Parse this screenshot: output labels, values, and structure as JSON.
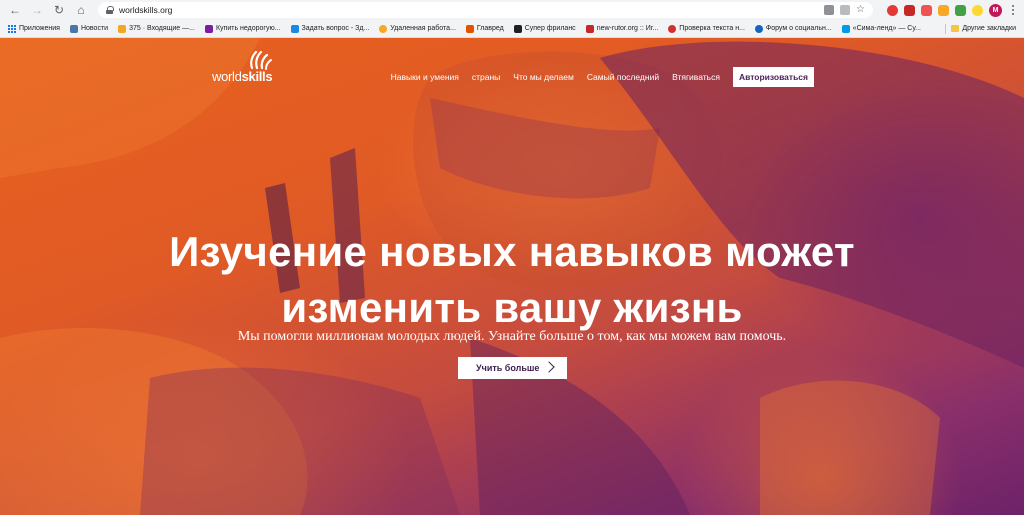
{
  "browser": {
    "url": "worldskills.org",
    "bookmarks": [
      {
        "label": "Приложения",
        "color": "#1a73e8"
      },
      {
        "label": "Новости",
        "color": "#4a76a8"
      },
      {
        "label": "375 · Входящие —...",
        "color": "#f5a623"
      },
      {
        "label": "Купить недорогую...",
        "color": "#7b1fa2"
      },
      {
        "label": "Задать вопрос - Зд...",
        "color": "#1e88e5"
      },
      {
        "label": "Удаленная работа...",
        "color": "#f9a825"
      },
      {
        "label": "Главред",
        "color": "#e65100"
      },
      {
        "label": "Супер фриланс",
        "color": "#212121"
      },
      {
        "label": "new-rutor.org :: Иг...",
        "color": "#c62828"
      },
      {
        "label": "Проверка текста н...",
        "color": "#d32f2f"
      },
      {
        "label": "Форум о социальн...",
        "color": "#1565c0"
      },
      {
        "label": "«Сима-ленд» — Су...",
        "color": "#039be5"
      }
    ],
    "other_bookmarks": "Другие закладки",
    "profile_initial": "M"
  },
  "site": {
    "logo_light": "world",
    "logo_bold": "skills",
    "nav": {
      "skills": "Навыки и умения",
      "countries": "страны",
      "what_we_do": "Что мы делаем",
      "latest": "Самый последний",
      "get_involved": "Втягиваться",
      "login": "Авторизоваться"
    },
    "headline_line1": "Изучение новых навыков может",
    "headline_line2": "изменить вашу жизнь",
    "subline": "Мы помогли миллионам молодых людей. Узнайте больше о том, как мы можем вам помочь.",
    "cta": "Учить больше"
  },
  "colors": {
    "hero_orange": "#e8611e",
    "hero_purple": "#6d2269",
    "cta_text": "#3d1d4d"
  }
}
